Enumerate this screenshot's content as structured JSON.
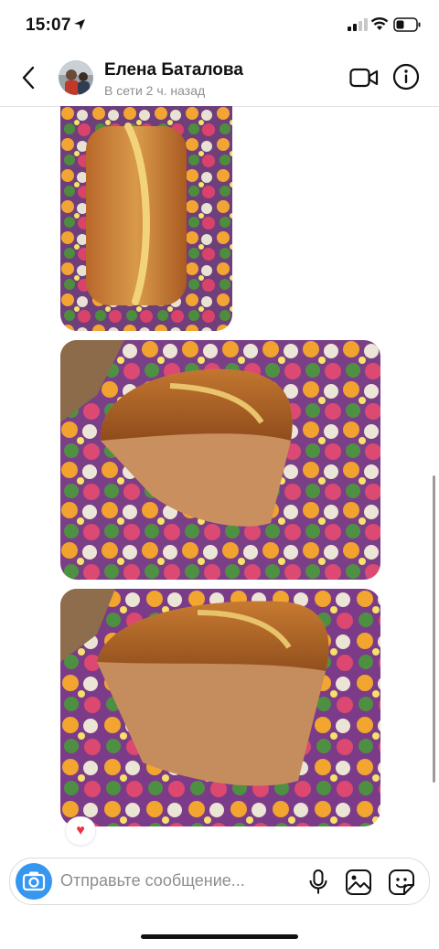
{
  "status_bar": {
    "time": "15:07"
  },
  "header": {
    "contact_name": "Елена Баталова",
    "presence": "В сети 2 ч. назад"
  },
  "messages": [
    {
      "type": "photo",
      "description_icon": "photo-bread-top-view"
    },
    {
      "type": "photo",
      "description_icon": "photo-bread-side-view"
    },
    {
      "type": "photo",
      "description_icon": "photo-bread-cut-view",
      "reaction": "♥"
    }
  ],
  "composer": {
    "placeholder": "Отправьте сообщение..."
  },
  "colors": {
    "accent": "#3797f0",
    "reaction": "#ed2f47",
    "muted": "#8e8e8e"
  }
}
